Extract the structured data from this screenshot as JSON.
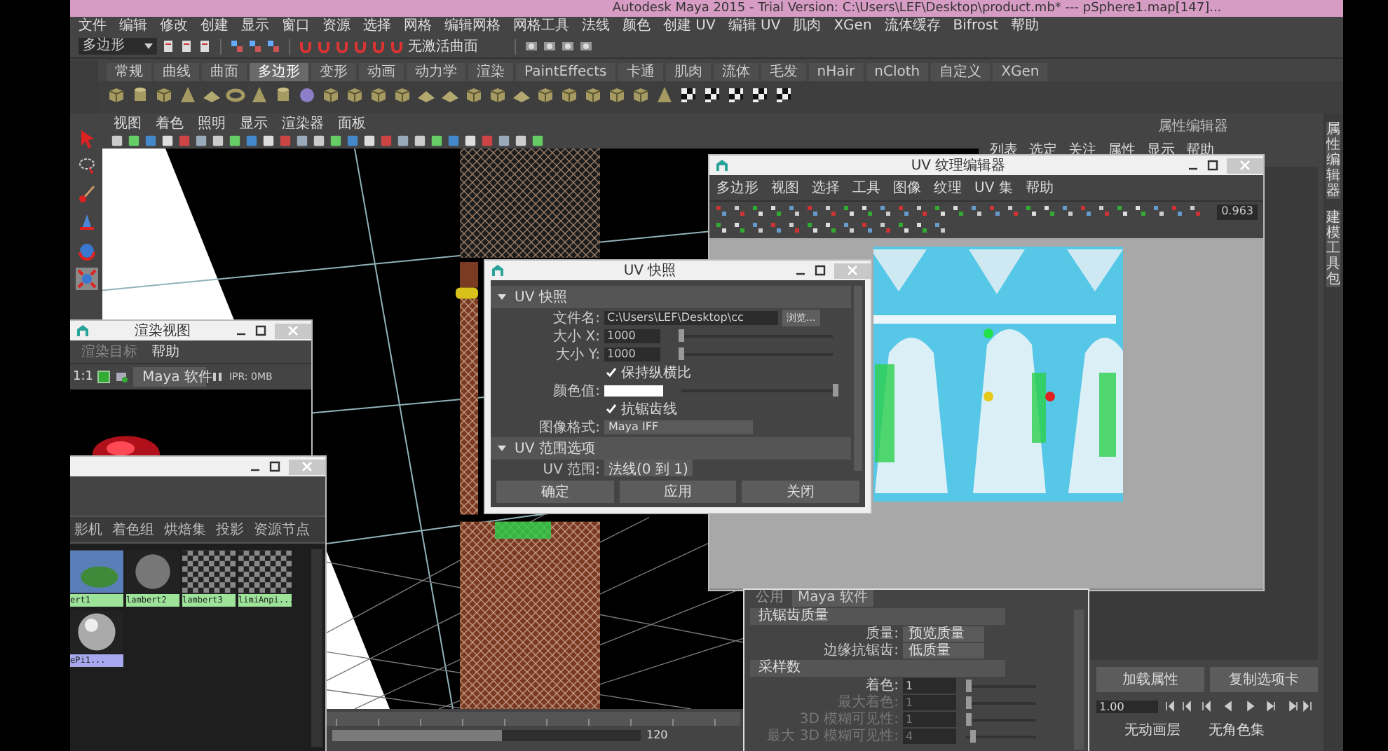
{
  "title_bar": {
    "title": "Autodesk Maya 2015 - Trial Version: C:\\Users\\LEF\\Desktop\\product.mb*  ---  pSphere1.map[147]..."
  },
  "menu_bar": [
    "文件",
    "编辑",
    "修改",
    "创建",
    "显示",
    "窗口",
    "资源",
    "选择",
    "网格",
    "编辑网格",
    "网格工具",
    "法线",
    "颜色",
    "创建 UV",
    "编辑 UV",
    "肌肉",
    "XGen",
    "流体缓存",
    "Bifrost",
    "帮助"
  ],
  "status_line": {
    "mode": "多边形",
    "live_surface": "无激活曲面"
  },
  "shelf_tabs": [
    {
      "label": "常规",
      "selected": false
    },
    {
      "label": "曲线",
      "selected": false
    },
    {
      "label": "曲面",
      "selected": false
    },
    {
      "label": "多边形",
      "selected": true
    },
    {
      "label": "变形",
      "selected": false
    },
    {
      "label": "动画",
      "selected": false
    },
    {
      "label": "动力学",
      "selected": false
    },
    {
      "label": "渲染",
      "selected": false
    },
    {
      "label": "PaintEffects",
      "selected": false
    },
    {
      "label": "卡通",
      "selected": false
    },
    {
      "label": "肌肉",
      "selected": false
    },
    {
      "label": "流体",
      "selected": false
    },
    {
      "label": "毛发",
      "selected": false
    },
    {
      "label": "nHair",
      "selected": false
    },
    {
      "label": "nCloth",
      "selected": false
    },
    {
      "label": "自定义",
      "selected": false
    },
    {
      "label": "XGen",
      "selected": false
    }
  ],
  "viewport": {
    "menu": [
      "视图",
      "着色",
      "照明",
      "显示",
      "渲染器",
      "面板"
    ]
  },
  "time_slider": {
    "range_end": "120",
    "level": 0.55
  },
  "attribute_editor": {
    "title": "属性编辑器",
    "menu": [
      "列表",
      "选定",
      "关注",
      "属性",
      "显示",
      "帮助"
    ],
    "side_tabs": [
      "属性编辑器",
      "建模工具包"
    ],
    "buttons": [
      "加载属性",
      "复制选项卡"
    ]
  },
  "playback": {
    "current_frame": "1.00",
    "anim_layer": "无动画层",
    "character_set": "无角色集"
  },
  "render_view": {
    "title": "渲染视图",
    "menu": [
      "渲染目标",
      "帮助"
    ],
    "ratio": "1:1",
    "renderer": "Maya 软件",
    "ipr": "IPR: 0MB"
  },
  "hypershade": {
    "tabs": [
      "影机",
      "着色组",
      "烘焙集",
      "投影",
      "资源节点"
    ],
    "swatches": [
      {
        "label": "ert1",
        "kind": "texture",
        "color": "#9de39a"
      },
      {
        "label": "lambert2",
        "kind": "sphere",
        "color": "#9de39a"
      },
      {
        "label": "lambert3",
        "kind": "checker",
        "color": "#9de39a"
      },
      {
        "label": "limiAnpi...",
        "kind": "checker",
        "color": "#9de39a"
      },
      {
        "label": "ePi1...",
        "kind": "chrome",
        "color": "#a8a8ee"
      }
    ]
  },
  "uv_editor": {
    "title": "UV 纹理编辑器",
    "menu": [
      "多边形",
      "视图",
      "选择",
      "工具",
      "图像",
      "纹理",
      "UV 集",
      "帮助"
    ],
    "value": "0.963"
  },
  "uv_snapshot": {
    "title": "UV 快照",
    "section_1": "UV 快照",
    "file_label": "文件名:",
    "file_value": "C:\\Users\\LEF\\Desktop\\cc",
    "browse": "浏览...",
    "size_x": {
      "label": "大小 X:",
      "value": "1000",
      "level": 0.02
    },
    "size_y": {
      "label": "大小 Y:",
      "value": "1000",
      "level": 0.02
    },
    "keep_ratio": {
      "label": "保持纵横比",
      "checked": true
    },
    "color": {
      "label": "颜色值:",
      "level": 1
    },
    "antialias": {
      "label": "抗锯齿线",
      "checked": true
    },
    "format": {
      "label": "图像格式:",
      "value": "Maya IFF"
    },
    "section_2": "UV 范围选项",
    "range": {
      "label": "UV 范围:",
      "value": "法线(0 到 1)"
    },
    "buttons": [
      "确定",
      "应用",
      "关闭"
    ]
  },
  "render_settings": {
    "tabs": [
      {
        "label": "公用",
        "selected": false
      },
      {
        "label": "Maya 软件",
        "selected": true
      }
    ],
    "sections": [
      {
        "title": "抗锯齿质量",
        "rows": [
          {
            "kind": "dropdown",
            "label": "质量:",
            "value": "预览质量",
            "disabled": false
          },
          {
            "kind": "dropdown",
            "label": "边缘抗锯齿:",
            "value": "低质量",
            "disabled": false
          }
        ]
      },
      {
        "title": "采样数",
        "rows": [
          {
            "kind": "slider",
            "label": "着色:",
            "value": "1",
            "level": 0,
            "disabled": false
          },
          {
            "kind": "slider",
            "label": "最大着色:",
            "value": "1",
            "level": 0,
            "disabled": true
          },
          {
            "kind": "slider",
            "label": "3D 模糊可见性:",
            "value": "1",
            "level": 0,
            "disabled": true
          },
          {
            "kind": "slider",
            "label": "最大 3D 模糊可见性:",
            "value": "4",
            "level": 0.06,
            "disabled": true
          }
        ]
      }
    ]
  }
}
